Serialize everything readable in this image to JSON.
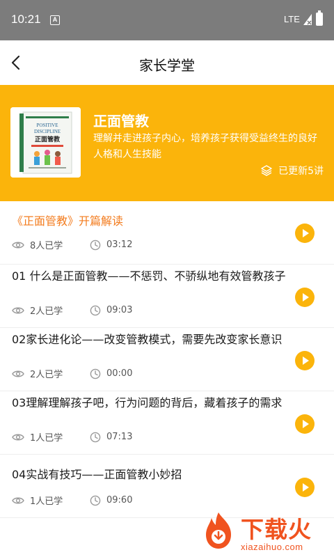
{
  "status_bar": {
    "time": "10:21",
    "notification_letter": "A",
    "network": "LTE"
  },
  "nav": {
    "title": "家长学堂"
  },
  "course": {
    "title": "正面管教",
    "description": "理解并走进孩子内心，培养孩子获得受益终生的良好人格和人生技能",
    "updated": "已更新5讲",
    "cover": {
      "title_line1": "POSITIVE",
      "title_line2": "DISCIPLINE",
      "title_cn": "正面管教"
    }
  },
  "lessons": [
    {
      "title": "《正面管教》开篇解读",
      "views": "8人已学",
      "duration": "03:12"
    },
    {
      "title": "01 什么是正面管教——不惩罚、不骄纵地有效管教孩子",
      "views": "2人已学",
      "duration": "09:03"
    },
    {
      "title": "02家长进化论——改变管教模式，需要先改变家长意识",
      "views": "2人已学",
      "duration": "00:00"
    },
    {
      "title": "03理解理解孩子吧，行为问题的背后，藏着孩子的需求",
      "views": "1人已学",
      "duration": "07:13"
    },
    {
      "title": "04实战有技巧——正面管教小妙招",
      "views": "1人已学",
      "duration": "09:60"
    }
  ],
  "watermark": {
    "text": "下载火",
    "url": "xiazaihuo.com"
  },
  "colors": {
    "accent": "#fbb40b",
    "highlight": "#f37b1d",
    "status_bar": "#7c7c7c"
  }
}
